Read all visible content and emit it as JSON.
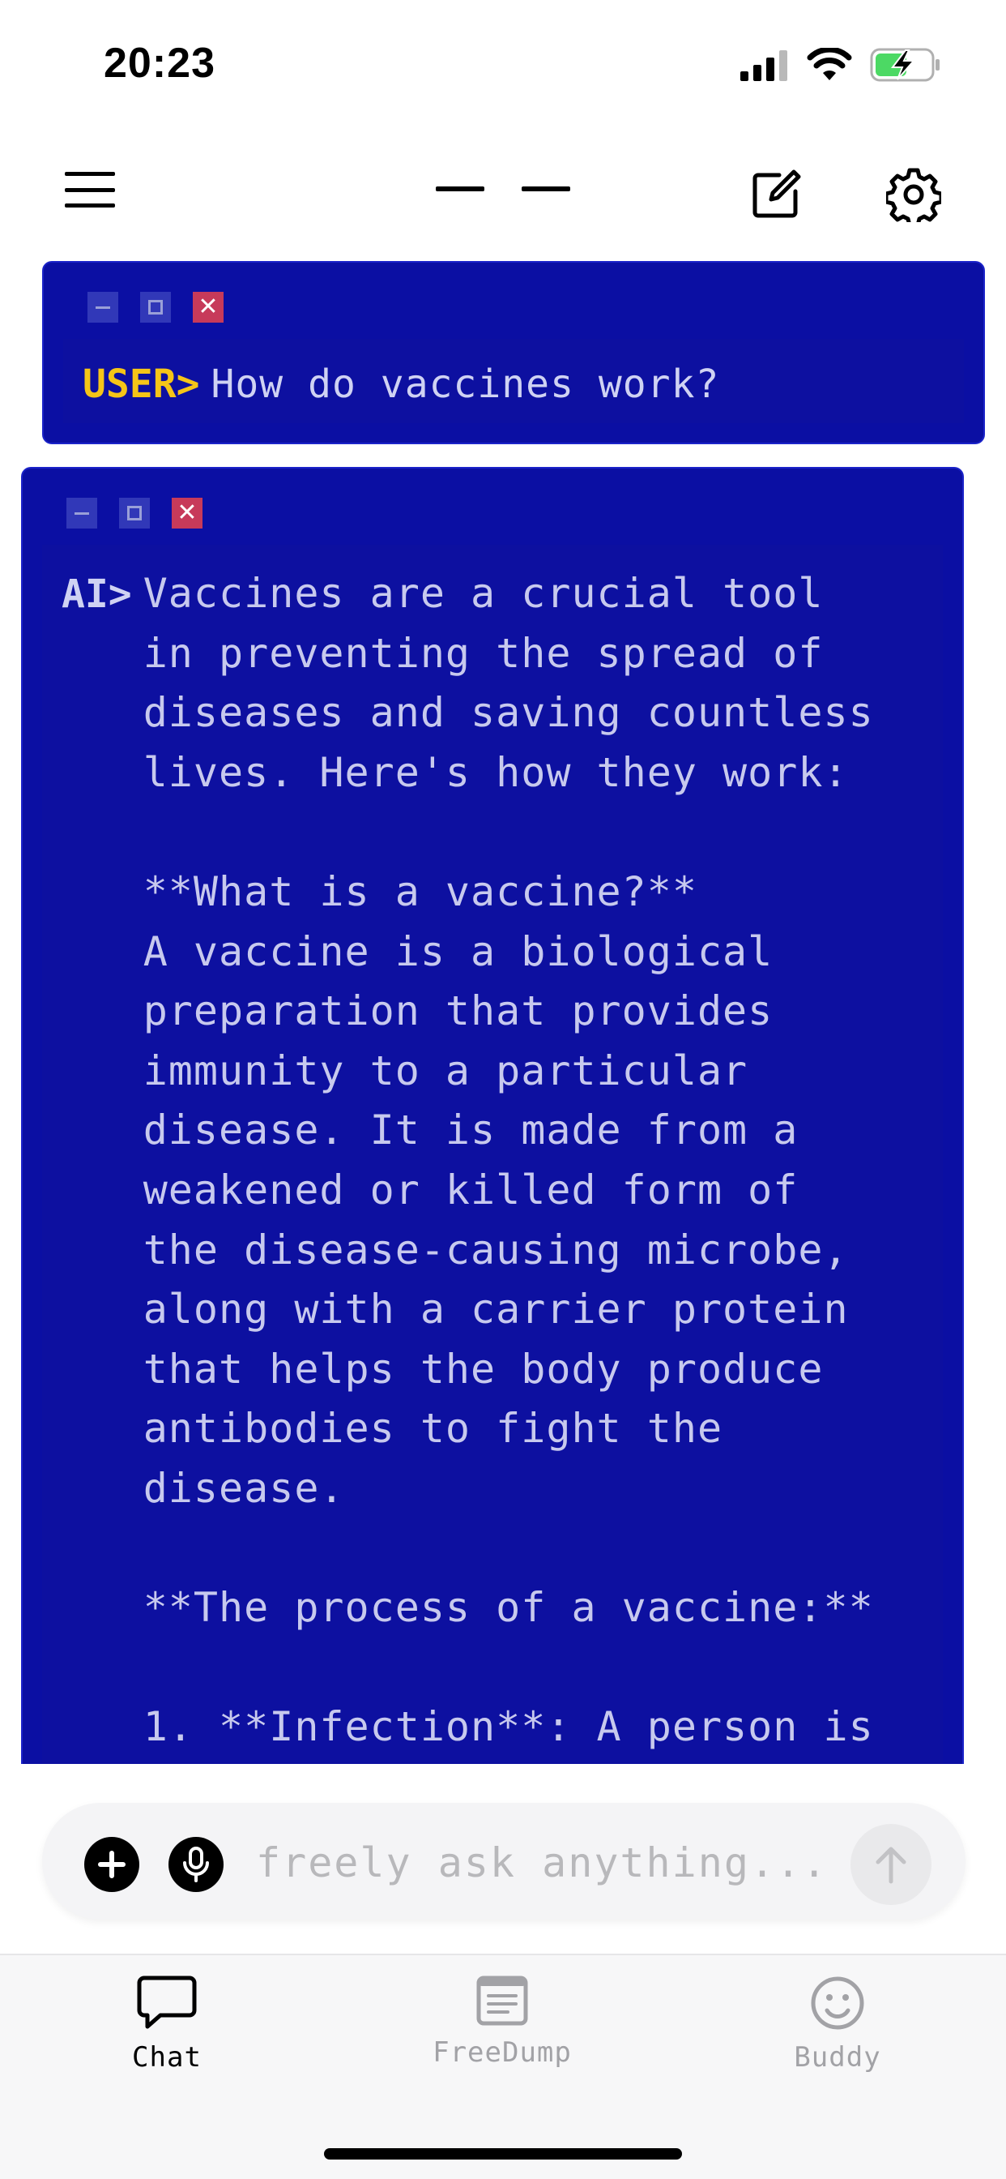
{
  "status_bar": {
    "time": "20:23",
    "icons": [
      "signal-icon",
      "wifi-icon",
      "battery-charging-icon"
    ],
    "battery_color": "#4cd964"
  },
  "header": {
    "icons": [
      "menu-icon",
      "title-dashes",
      "compose-icon",
      "gear-icon"
    ]
  },
  "user_message": {
    "label": "USER>",
    "text": "How do vaccines work?",
    "label_color": "#f5c518"
  },
  "ai_message": {
    "label": "AI>",
    "text": "Vaccines are a crucial tool\nin preventing the spread of\ndiseases and saving countless\nlives. Here's how they work:\n\n**What is a vaccine?**\nA vaccine is a biological\npreparation that provides\nimmunity to a particular\ndisease. It is made from a\nweakened or killed form of\nthe disease-causing microbe,\nalong with a carrier protein\nthat helps the body produce\nantibodies to fight the\ndisease.\n\n**The process of a vaccine:**\n\n1. **Infection**: A person is"
  },
  "window_controls": {
    "close_glyph": "✕",
    "close_color": "#c73a5a"
  },
  "input": {
    "placeholder": "freely ask anything..."
  },
  "tabs": [
    {
      "label": "Chat",
      "icon": "chat-bubble-icon",
      "active": true
    },
    {
      "label": "FreeDump",
      "icon": "note-icon",
      "active": false
    },
    {
      "label": "Buddy",
      "icon": "smiley-icon",
      "active": false
    }
  ],
  "colors": {
    "window_bg": "#0b0fa3",
    "text": "#c7c9ee"
  }
}
